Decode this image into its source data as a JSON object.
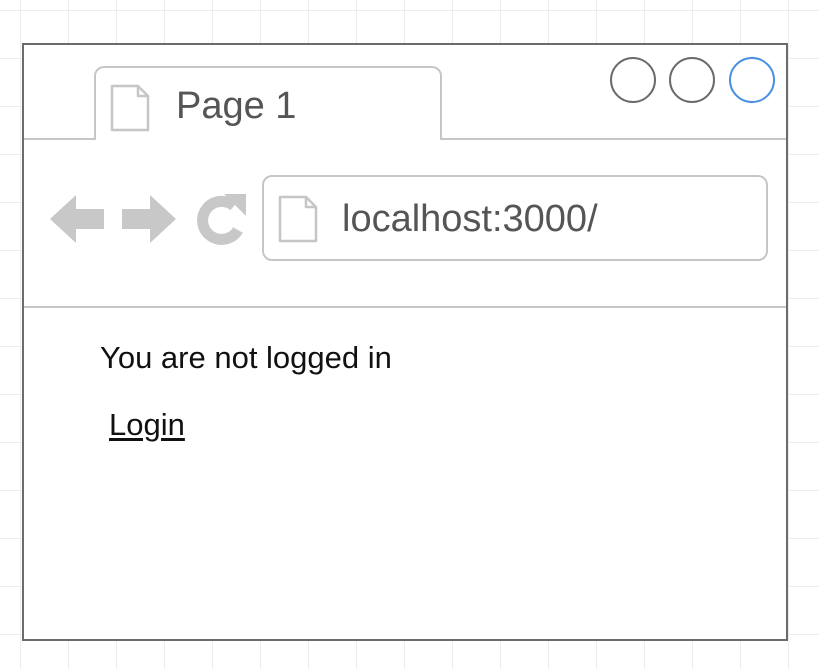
{
  "browser": {
    "tab": {
      "title": "Page 1",
      "icon": "document-icon"
    },
    "window_controls": [
      {
        "name": "window-button-1",
        "color": "#6b6b6b"
      },
      {
        "name": "window-button-2",
        "color": "#6b6b6b"
      },
      {
        "name": "window-button-3",
        "color": "#4a90e2"
      }
    ],
    "toolbar": {
      "back_icon": "back-arrow-icon",
      "forward_icon": "forward-arrow-icon",
      "reload_icon": "reload-icon",
      "address": "localhost:3000/"
    }
  },
  "page": {
    "status": "You are not logged in",
    "login_link": "Login"
  },
  "colors": {
    "frame": "#6b6b6b",
    "chrome_line": "#c6c6c6",
    "icon_gray": "#c8c8c8",
    "accent_blue": "#4a90e2"
  }
}
